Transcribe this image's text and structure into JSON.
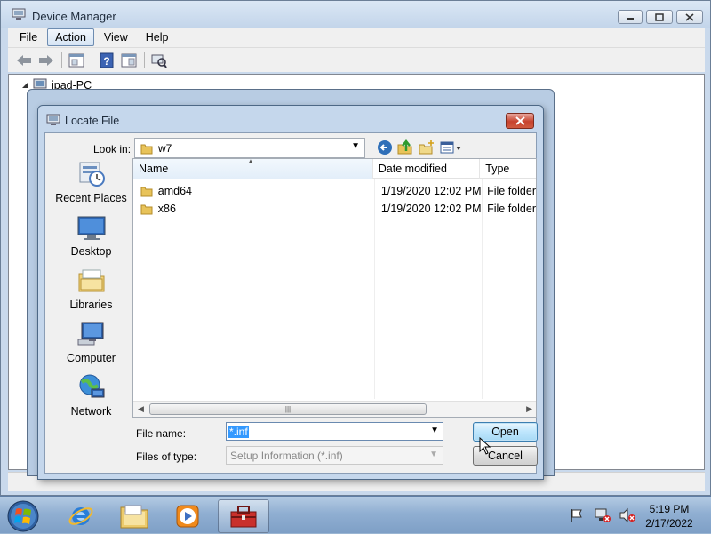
{
  "device_manager": {
    "title": "Device Manager",
    "menu": [
      {
        "label": "File"
      },
      {
        "label": "Action"
      },
      {
        "label": "View"
      },
      {
        "label": "Help"
      }
    ],
    "toolbar": [
      "back-icon",
      "forward-icon",
      "properties-icon",
      "help-icon",
      "view-icon",
      "scan-hardware-icon"
    ],
    "tree_root": "ipad-PC"
  },
  "locate_file": {
    "title": "Locate File",
    "look_in_label": "Look in:",
    "look_in_value": "w7",
    "places": [
      {
        "label": "Recent Places",
        "icon": "recent-places-icon"
      },
      {
        "label": "Desktop",
        "icon": "desktop-icon"
      },
      {
        "label": "Libraries",
        "icon": "libraries-icon"
      },
      {
        "label": "Computer",
        "icon": "computer-icon"
      },
      {
        "label": "Network",
        "icon": "network-icon"
      }
    ],
    "columns": [
      "Name",
      "Date modified",
      "Type"
    ],
    "files": [
      {
        "name": "amd64",
        "date": "1/19/2020 12:02 PM",
        "type": "File folder"
      },
      {
        "name": "x86",
        "date": "1/19/2020 12:02 PM",
        "type": "File folder"
      }
    ],
    "file_name_label": "File name:",
    "file_name_value": "*.inf",
    "file_type_label": "Files of type:",
    "file_type_value": "Setup Information (*.inf)",
    "open_label": "Open",
    "cancel_label": "Cancel"
  },
  "taskbar": {
    "apps": [
      "internet-explorer-icon",
      "windows-explorer-icon",
      "media-player-icon",
      "toolbox-icon"
    ],
    "time": "5:19 PM",
    "date": "2/17/2022"
  },
  "colors": {
    "selection": "#3399ff",
    "close_button": "#c7432e",
    "taskbar": "#90afd2"
  }
}
